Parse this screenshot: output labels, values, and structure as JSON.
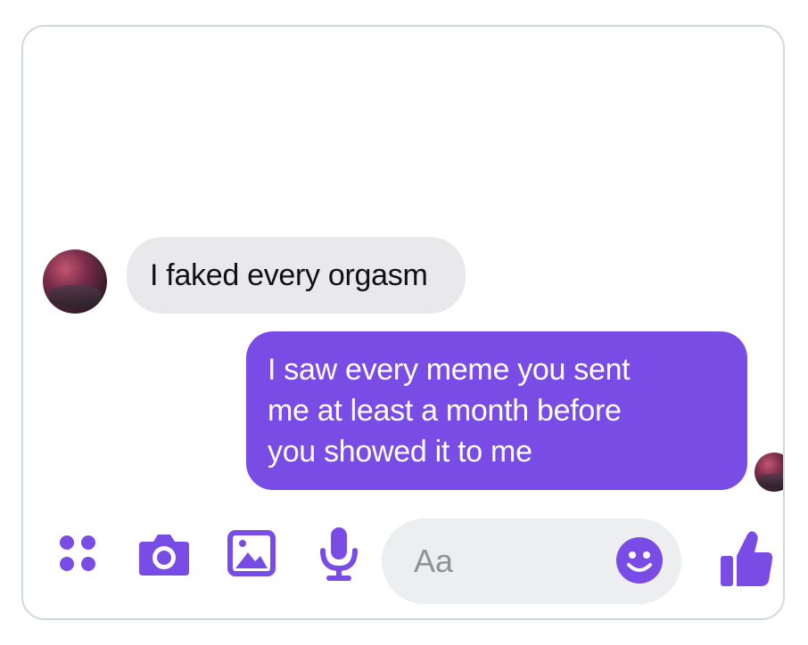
{
  "conversation": {
    "messages": [
      {
        "direction": "incoming",
        "text": "I faked every orgasm"
      },
      {
        "direction": "outgoing",
        "lines": [
          "I saw every meme you sent",
          "me at least a month before",
          "you showed it to me"
        ]
      }
    ]
  },
  "composer": {
    "placeholder": "Aa",
    "icons": [
      "apps-grid-icon",
      "camera-icon",
      "image-icon",
      "microphone-icon",
      "emoji-icon",
      "thumbs-up-icon"
    ]
  },
  "theme": {
    "accent": "#7a4ce6",
    "incoming_bubble": "#e9e9eb",
    "input_background": "#eceef0"
  }
}
